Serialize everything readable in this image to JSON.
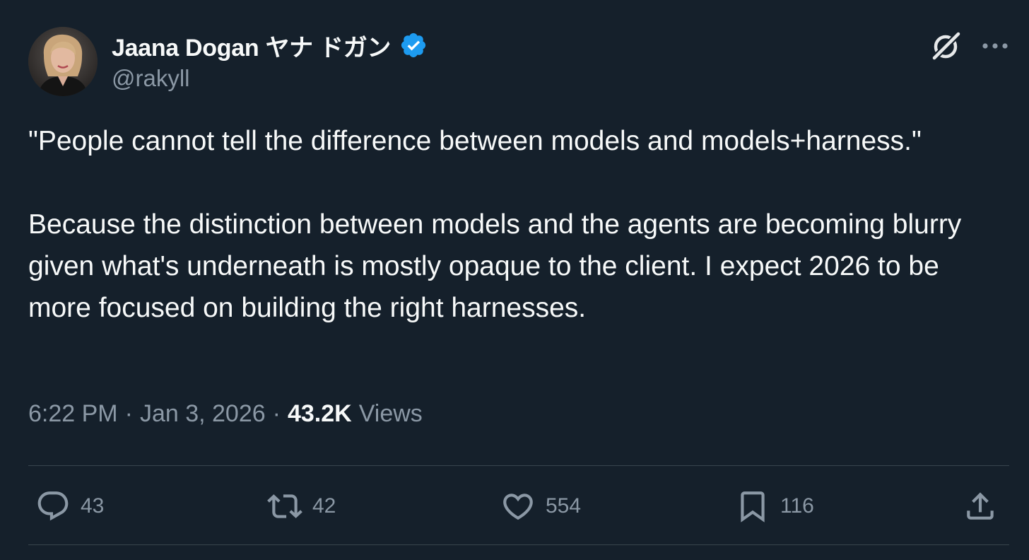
{
  "author": {
    "display_name": "Jaana Dogan ヤナ ドガン",
    "handle": "@rakyll",
    "verified": true,
    "verified_color": "#1d9bf0"
  },
  "header_icons": {
    "grok": "grok-icon",
    "more": "more-icon"
  },
  "tweet": {
    "paragraph_1": "\"People cannot tell the difference between models and models+harness.\"",
    "paragraph_2": "Because the distinction between models and the agents are becoming blurry given what's underneath is mostly opaque to the client. I expect 2026 to be more focused on building the right harnesses."
  },
  "meta": {
    "time": "6:22 PM",
    "separator": "·",
    "date": "Jan 3, 2026",
    "views_count": "43.2K",
    "views_label": "Views"
  },
  "actions": {
    "reply_count": "43",
    "retweet_count": "42",
    "like_count": "554",
    "bookmark_count": "116"
  },
  "colors": {
    "background": "#15202b",
    "text_primary": "#f7f9f9",
    "text_secondary": "#8b98a5",
    "divider": "#38444d"
  }
}
